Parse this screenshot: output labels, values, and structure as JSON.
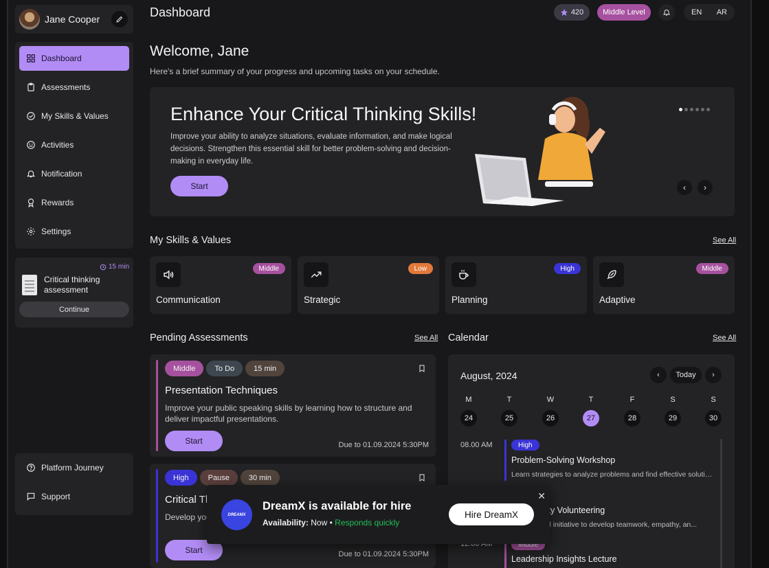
{
  "user": {
    "name": "Jane Cooper"
  },
  "sidebar": {
    "items": [
      {
        "label": "Dashboard",
        "icon": "dashboard-icon",
        "active": true
      },
      {
        "label": "Assessments",
        "icon": "clipboard-icon"
      },
      {
        "label": "My Skills & Values",
        "icon": "check-circle-icon"
      },
      {
        "label": "Activities",
        "icon": "smile-icon"
      },
      {
        "label": "Notification",
        "icon": "bell-icon"
      },
      {
        "label": "Rewards",
        "icon": "award-icon"
      },
      {
        "label": "Settings",
        "icon": "gear-icon"
      }
    ],
    "assessment_card": {
      "time": "15 min",
      "title": "Critical thinking assessment",
      "button": "Continue"
    },
    "bottom": [
      {
        "label": "Platform Journey",
        "icon": "help-circle-icon"
      },
      {
        "label": "Support",
        "icon": "message-icon"
      }
    ]
  },
  "header": {
    "title": "Dashboard",
    "points": "420",
    "level": "Middle Level",
    "languages": [
      "EN",
      "AR"
    ]
  },
  "welcome": {
    "title": "Welcome, Jane",
    "subtitle": "Here's a brief summary of your progress and upcoming tasks on your schedule."
  },
  "hero": {
    "title": "Enhance Your Critical Thinking Skills!",
    "body": "Improve your ability to analyze situations, evaluate information, and make logical decisions. Strengthen this essential skill for better problem-solving and decision-making in everyday life.",
    "button": "Start",
    "slides": 6,
    "active_slide": 1
  },
  "skills": {
    "title": "My Skills & Values",
    "see_all": "See All",
    "items": [
      {
        "label": "Communication",
        "badge": "Middle",
        "badge_color": "#a6519f",
        "icon": "speaker-icon"
      },
      {
        "label": "Strategic",
        "badge": "Low",
        "badge_color": "#e2793a",
        "icon": "trending-up-icon"
      },
      {
        "label": "Planning",
        "badge": "High",
        "badge_color": "#3a34d6",
        "icon": "coffee-icon"
      },
      {
        "label": "Adaptive",
        "badge": "Middle",
        "badge_color": "#a6519f",
        "icon": "feather-icon"
      }
    ]
  },
  "pending": {
    "title": "Pending Assessments",
    "see_all": "See All",
    "items": [
      {
        "tags": [
          "Middle",
          "To Do",
          "15 min"
        ],
        "title": "Presentation Techniques",
        "desc": "Improve your public speaking skills by learning how to structure and deliver impactful presentations.",
        "button": "Start",
        "due": "Due to 01.09.2024 5:30PM",
        "accent": "#a6519f"
      },
      {
        "tags": [
          "High",
          "Pause",
          "30 min"
        ],
        "title": "Critical Thinking",
        "desc": "Develop your analytical skills and make well-reasoned decisions.",
        "button": "Start",
        "due": "Due to 01.09.2024 5:30PM",
        "accent": "#3a34d6"
      }
    ]
  },
  "calendar": {
    "title": "Calendar",
    "see_all": "See All",
    "month": "August, 2024",
    "today": "Today",
    "weekdays": [
      "M",
      "T",
      "W",
      "T",
      "F",
      "S",
      "S"
    ],
    "days": [
      "24",
      "25",
      "26",
      "27",
      "28",
      "29",
      "30"
    ],
    "selected_day": "27",
    "events": [
      {
        "time": "08.00 AM",
        "badge": "High",
        "badge_color": "#3a34d6",
        "title": "Problem-Solving Workshop",
        "desc": "Learn strategies to analyze problems and find effective solutio..."
      },
      {
        "time": "",
        "badge": "",
        "title": "Community Volunteering",
        "desc": "Join a social initiative to develop teamwork, empathy, an..."
      },
      {
        "time": "12.00 AM",
        "badge": "Middle",
        "badge_color": "#a6519f",
        "title": "Leadership Insights Lecture",
        "desc": ""
      }
    ]
  },
  "toast": {
    "logo": "DREAMX",
    "title": "DreamX is available for hire",
    "availability_label": "Availability:",
    "availability_value": "Now",
    "responds": "Responds quickly",
    "button": "Hire DreamX"
  }
}
